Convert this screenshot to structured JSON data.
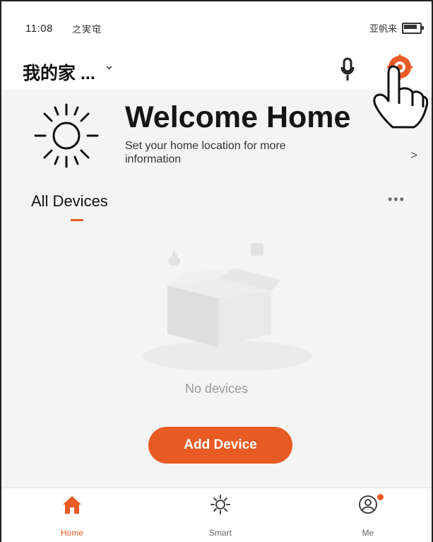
{
  "status_bar": {
    "time": "11:08",
    "signal_text": "····",
    "left_icons_text": "之実窀",
    "right_icons_text": "亚帆来"
  },
  "header": {
    "home_name": "我的家 ...",
    "home_chevron": "⌄"
  },
  "welcome": {
    "title": "Welcome Home",
    "subtitle": "Set your home location for more information",
    "arrow": ">"
  },
  "devices": {
    "section_title": "All Devices",
    "more": "•••",
    "empty_text": "No devices",
    "add_button": "Add Device"
  },
  "bottom_nav": [
    {
      "label": "Home",
      "icon": "home-icon"
    },
    {
      "label": "Smart",
      "icon": "smart-icon"
    },
    {
      "label": "Me",
      "icon": "me-icon"
    }
  ],
  "colors": {
    "accent": "#e85b25",
    "background": "#f4f4f4",
    "surface": "#ffffff"
  }
}
